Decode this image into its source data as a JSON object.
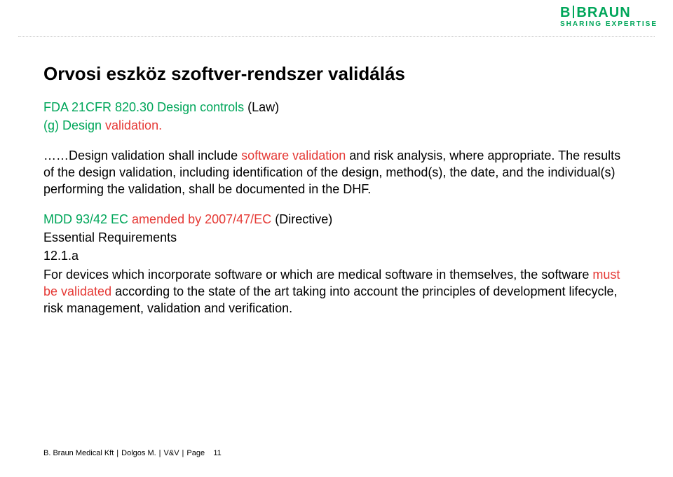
{
  "logo": {
    "brand_left": "B",
    "brand_right": "BRAUN",
    "tagline": "SHARING EXPERTISE"
  },
  "title": "Orvosi eszköz szoftver-rendszer validálás",
  "sec1": {
    "l1a": "FDA 21CFR 820.30 Design controls",
    "l1b": " (Law)",
    "l2a": "(g) Design ",
    "l2b": "validation.",
    "p1a": "……Design validation shall include ",
    "p1b": "software validation ",
    "p1c": "and risk analysis, where appropriate. The results of the design validation, including identification of the design, method(s), the date, and the individual(s) performing the validation, shall be documented in the DHF."
  },
  "sec2": {
    "h1a": "MDD 93/42 EC ",
    "h1b": "amended by 2007/47/EC",
    "h1c": " (Directive)",
    "l2": "Essential Requirements",
    "l3": "12.1.a",
    "p1a": "For devices which incorporate software or which are medical software in themselves, the software ",
    "p1b": "must be validated ",
    "p1c": "according to the state of the art taking into account the principles of development lifecycle, risk management, validation and verification."
  },
  "footer": {
    "org": "B. Braun Medical Kft",
    "author": "Dolgos M.",
    "section": "V&V",
    "page_label": "Page",
    "page_num": "11"
  }
}
